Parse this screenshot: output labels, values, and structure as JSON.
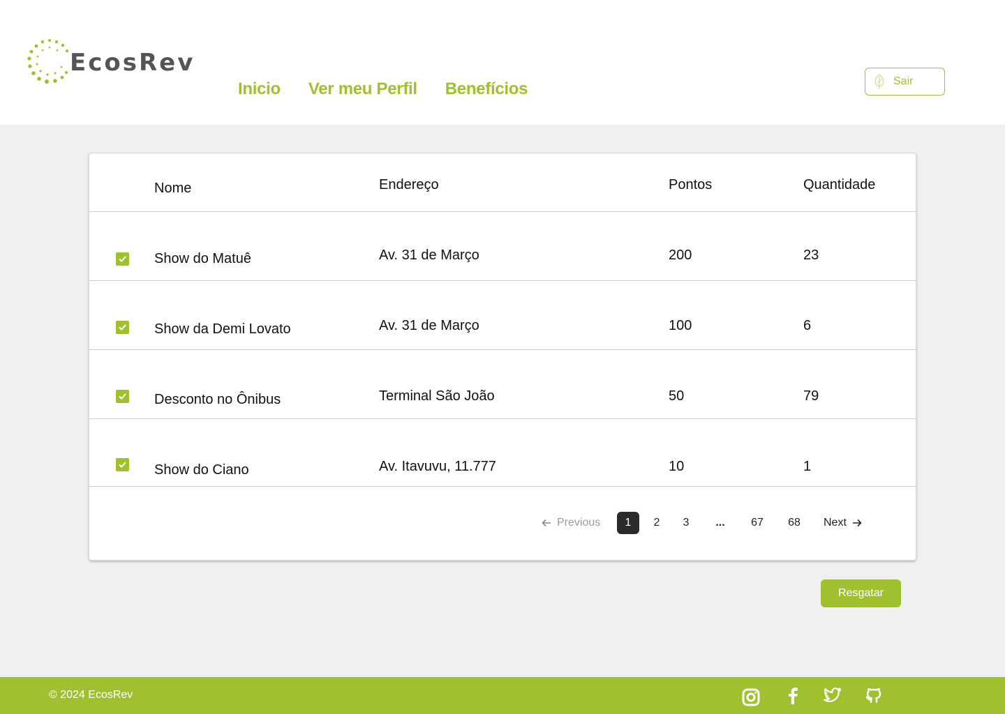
{
  "brand": {
    "name": "EcosRev",
    "accent": "#a0c12f"
  },
  "nav": [
    {
      "label": "Inicio"
    },
    {
      "label": "Ver meu Perfil"
    },
    {
      "label": "Benefícios"
    }
  ],
  "logout": {
    "label": "Sair",
    "icon": "leaf-icon"
  },
  "table": {
    "headers": [
      "Nome",
      "Endereço",
      "Pontos",
      "Quantidade"
    ],
    "rows": [
      {
        "checked": true,
        "nome": "Show do Matuê",
        "endereco": "Av. 31 de Março",
        "pontos": "200",
        "quantidade": "23"
      },
      {
        "checked": true,
        "nome": "Show da Demi Lovato",
        "endereco": "Av. 31 de Março",
        "pontos": "100",
        "quantidade": "6"
      },
      {
        "checked": true,
        "nome": "Desconto no Ônibus",
        "endereco": "Terminal São João",
        "pontos": "50",
        "quantidade": "79"
      },
      {
        "checked": true,
        "nome": "Show do Ciano",
        "endereco": "Av. Itavuvu, 11.777",
        "pontos": "10",
        "quantidade": "1"
      }
    ]
  },
  "pagination": {
    "previous": "Previous",
    "next": "Next",
    "pages": [
      "1",
      "2",
      "3",
      "...",
      "67",
      "68"
    ],
    "current": "1"
  },
  "redeem_button": "Resgatar",
  "footer": {
    "copyright": "© 2024 EcosRev",
    "social": [
      "instagram-icon",
      "facebook-icon",
      "twitter-icon",
      "github-icon"
    ]
  }
}
